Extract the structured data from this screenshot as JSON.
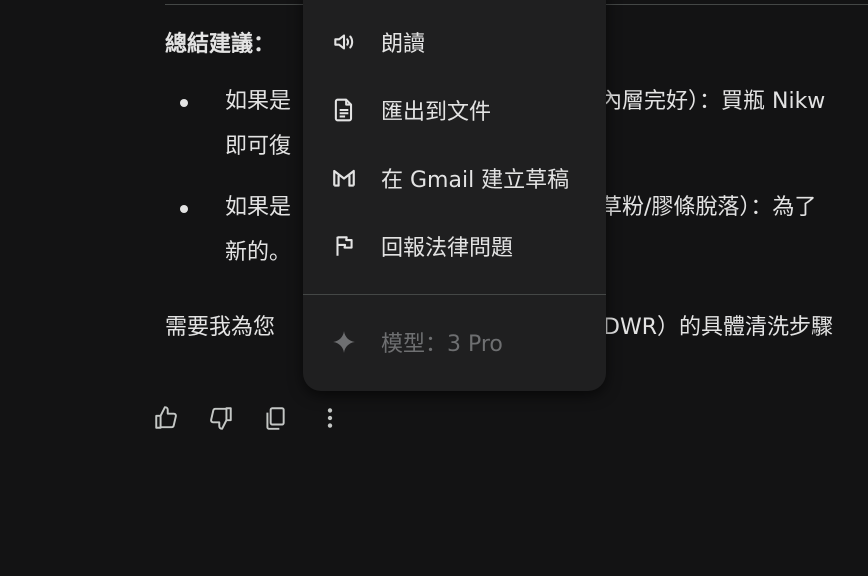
{
  "summary": {
    "heading": "總結建議：",
    "bullet1_line1_a": "如果是",
    "bullet1_line1_b": "內層完好）：買瓶 Nikw",
    "bullet1_line2": "即可復",
    "bullet2_line1_a": "如果是",
    "bullet2_line1_b": "草粉/膠條脫落）：為了",
    "bullet2_line2": "新的。",
    "followup_a": "需要我為您",
    "followup_b": "DWR）的具體清洗步驟"
  },
  "menu": {
    "items": [
      {
        "label": "朗讀",
        "icon": "volume-icon"
      },
      {
        "label": "匯出到文件",
        "icon": "document-icon"
      },
      {
        "label": "在 Gmail 建立草稿",
        "icon": "gmail-icon"
      },
      {
        "label": "回報法律問題",
        "icon": "flag-icon"
      }
    ],
    "model_label": "模型：3 Pro",
    "model_icon": "sparkle-icon"
  },
  "actions": {
    "icons": [
      "thumbs-up-icon",
      "thumbs-down-icon",
      "copy-icon",
      "more-vert-icon"
    ]
  }
}
